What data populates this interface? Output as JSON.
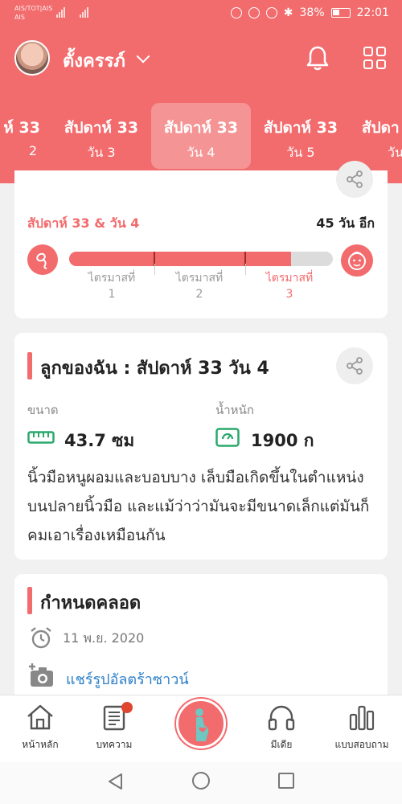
{
  "status_bar": {
    "carrier_line1": "AIS/TOT|AIS",
    "carrier_line2": "AIS",
    "battery": "38%",
    "time": "22:01"
  },
  "header": {
    "username": "ตั้งครรภ์",
    "weeks": [
      {
        "title": "ห์ 33",
        "day": "2"
      },
      {
        "title": "สัปดาห์ 33",
        "day": "วัน 3"
      },
      {
        "title": "สัปดาห์ 33",
        "day": "วัน 4",
        "active": true
      },
      {
        "title": "สัปดาห์ 33",
        "day": "วัน 5"
      },
      {
        "title": "สัปดา",
        "day": "วัน"
      }
    ]
  },
  "progress": {
    "title": "สัปดาห์ 33 & วัน 4",
    "days_left": "45 วัน อีก",
    "progress_fraction": 0.84,
    "trimesters": [
      {
        "label": "ไตรมาสที่",
        "num": "1"
      },
      {
        "label": "ไตรมาสที่",
        "num": "2"
      },
      {
        "label": "ไตรมาสที่",
        "num": "3"
      }
    ]
  },
  "baby": {
    "title": "ลูกของฉัน : สัปดาห์ 33 วัน 4",
    "size_label": "ขนาด",
    "size_value": "43.7 ซม",
    "weight_label": "น้ำหนัก",
    "weight_value": "1900 ก",
    "description": "นิ้วมือหนูผอมและบอบบาง เล็บมือเกิดขึ้นในตำแหน่งบนปลายนิ้วมือ และแม้ว่าว่ามันจะมีขนาดเล็กแต่มันก็คมเอาเรื่องเหมือนกัน"
  },
  "due": {
    "title": "กำหนดคลอด",
    "date": "11 พ.ย. 2020",
    "share_ultrasound": "แชร์รูปอัลตร้าซาวน์"
  },
  "bottom_nav": {
    "home": "หน้าหลัก",
    "articles": "บทความ",
    "media": "มีเดีย",
    "quiz": "แบบสอบถาม"
  },
  "colors": {
    "accent": "#f26b6d",
    "link": "#2c7fc8",
    "size_icon": "#2aa86b"
  }
}
